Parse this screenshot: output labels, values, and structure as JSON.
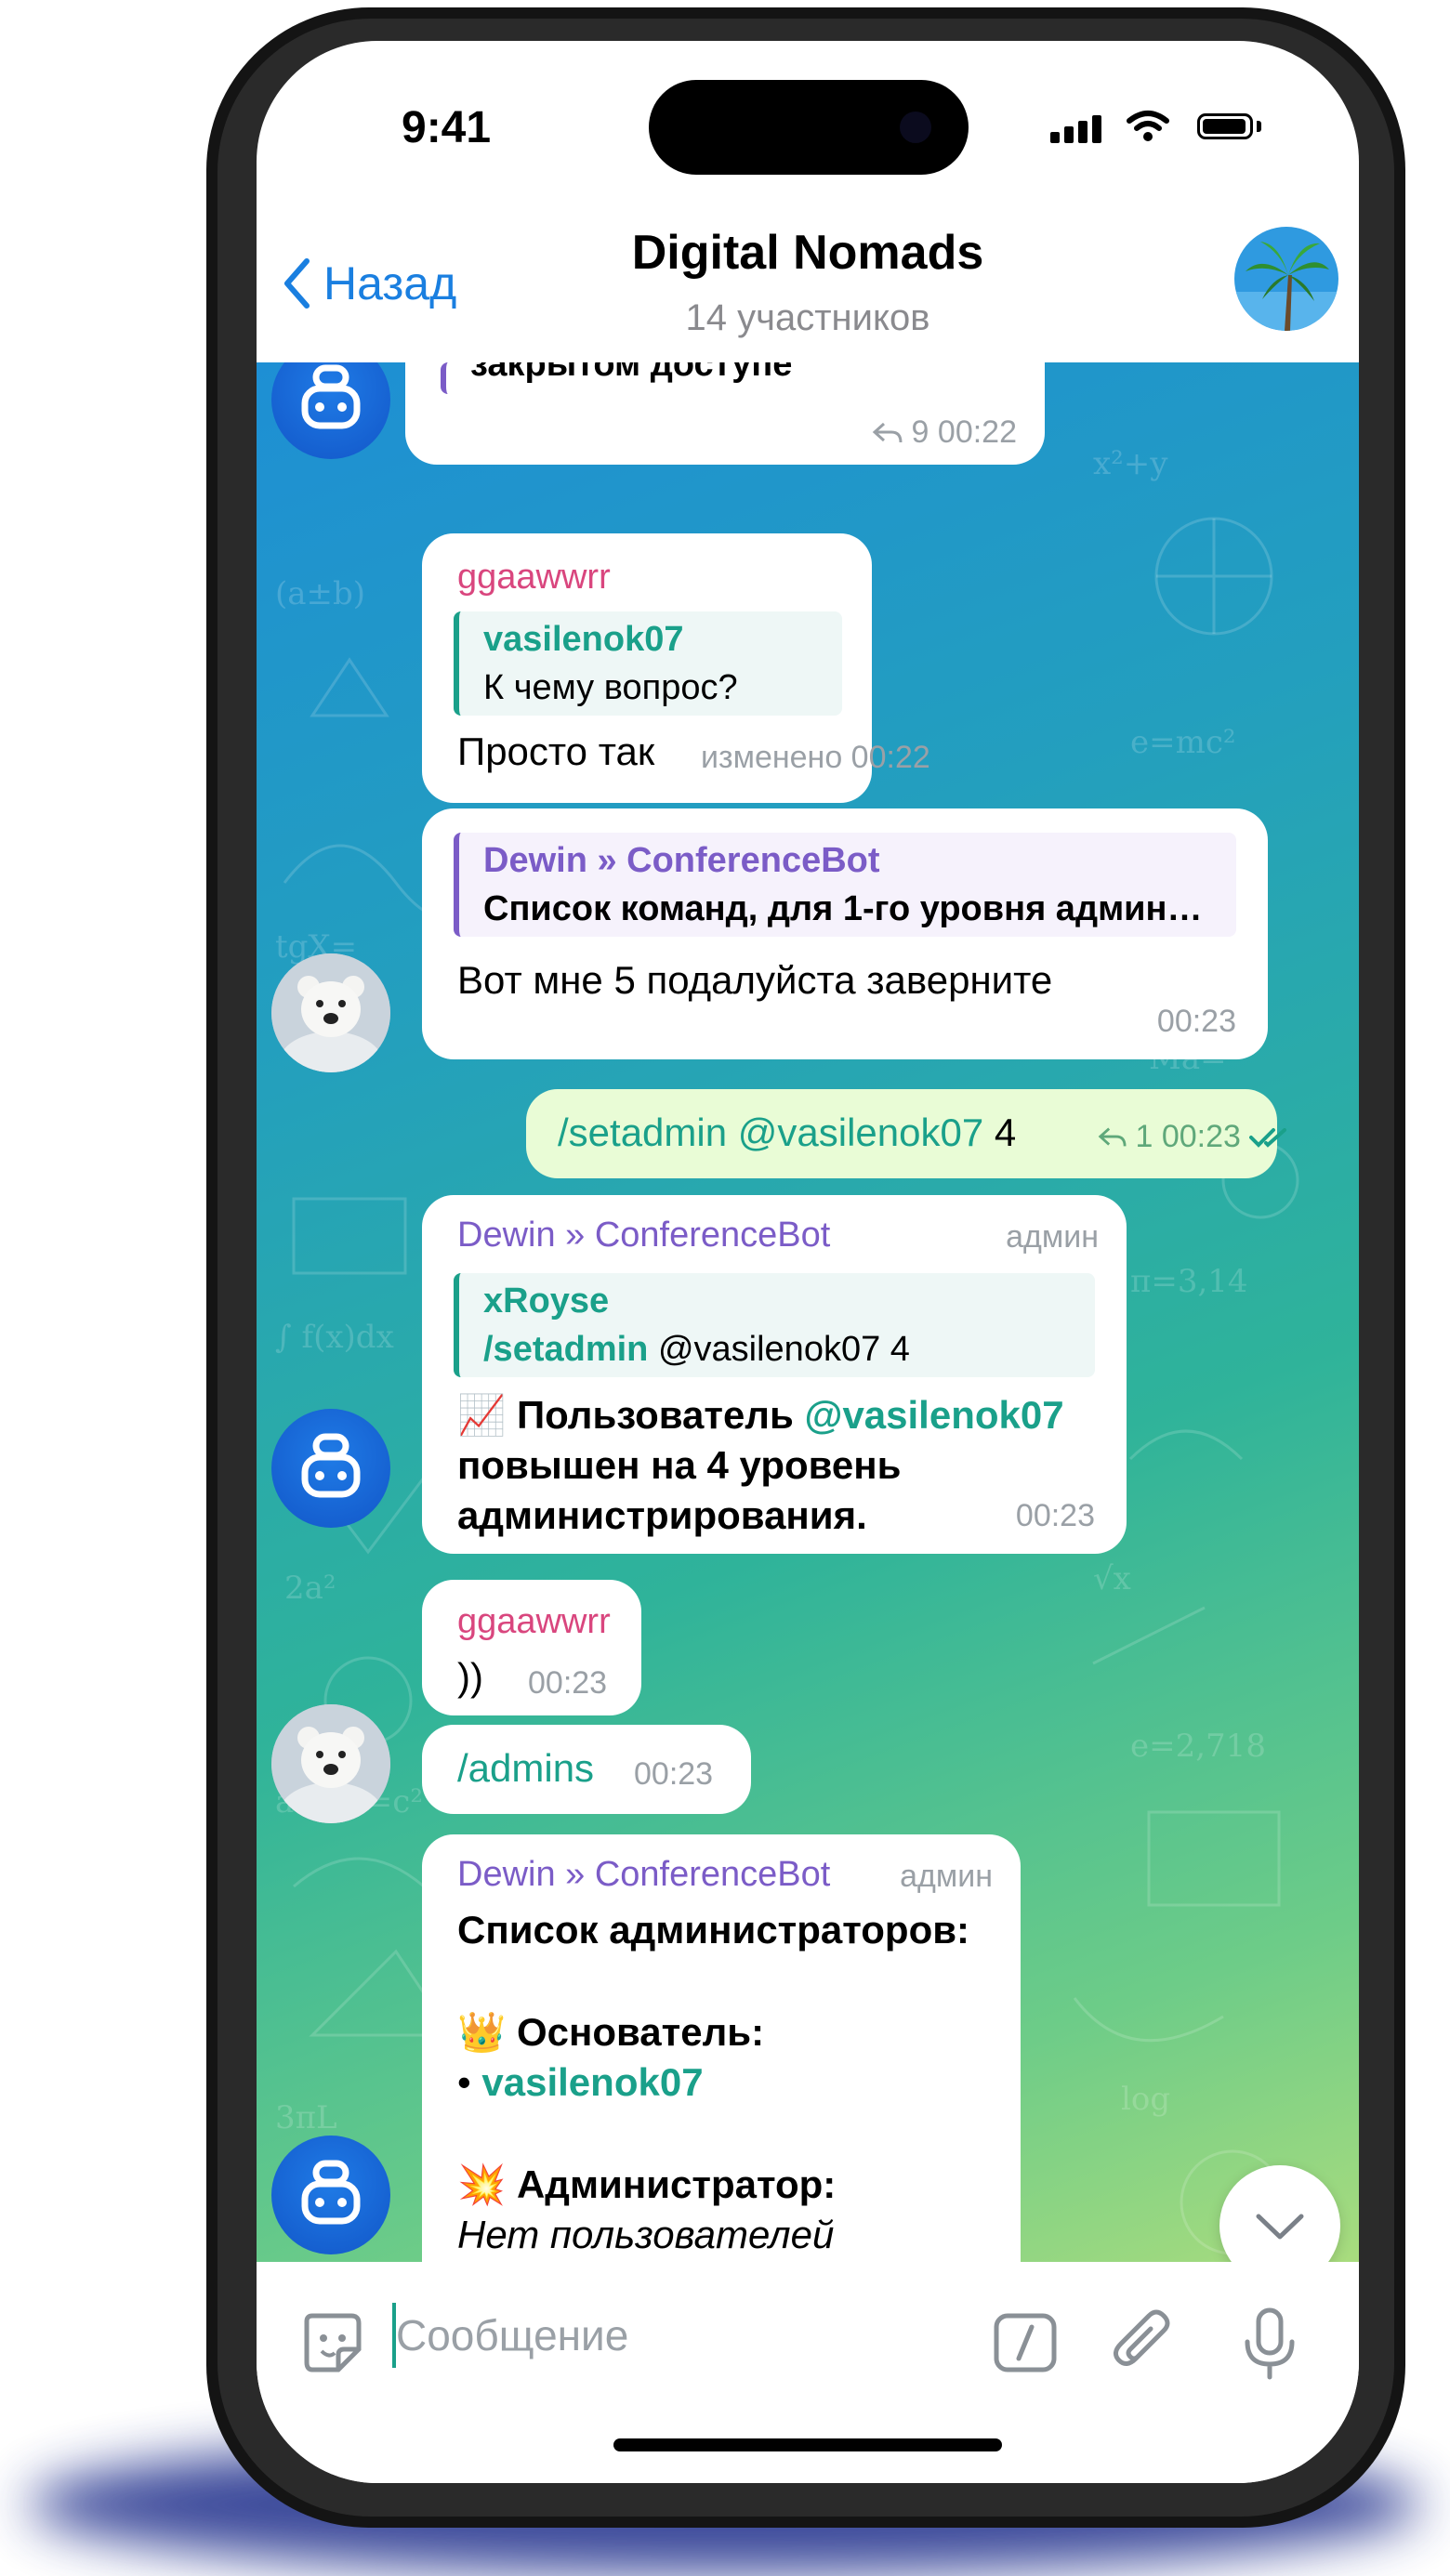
{
  "status_bar": {
    "time": "9:41"
  },
  "header": {
    "back_label": "Назад",
    "title": "Digital Nomads",
    "subtitle": "14 участников"
  },
  "messages": [
    {
      "text_partial": "закрытом доступе",
      "replies": "9",
      "time": "00:22"
    },
    {
      "sender": "ggaawwrr",
      "reply_to_name": "vasilenok07",
      "reply_to_text": "К чему вопрос?",
      "text": "Просто так",
      "edited_time": "изменено 00:22"
    },
    {
      "reply_to_name": "Dewin » ConferenceBot",
      "reply_to_text": "Список команд, для 1-го уровня админ…",
      "text": "Вот мне 5 подалуйста заверните",
      "time": "00:23"
    },
    {
      "command": "/setadmin",
      "mention": "@vasilenok07",
      "arg": "4",
      "replies": "1",
      "time": "00:23"
    },
    {
      "sender": "Dewin » ConferenceBot",
      "role": "админ",
      "reply_to_name": "xRoyse",
      "reply_to_cmd": "/setadmin",
      "reply_to_rest": "@vasilenok07 4",
      "emoji": "📈",
      "line1_prefix": "Пользователь",
      "line1_mention": "@vasilenok07",
      "line2": "повышен на 4 уровень",
      "line3": "администрирования.",
      "time": "00:23"
    },
    {
      "sender": "ggaawwrr",
      "text": "))",
      "time": "00:23"
    },
    {
      "text": "/admins",
      "time": "00:23"
    },
    {
      "sender": "Dewin » ConferenceBot",
      "role": "админ",
      "heading": "Список администраторов:",
      "founder_emoji": "👑",
      "founder_label": "Основатель:",
      "founder_bullet": "•",
      "founder_name": "vasilenok07",
      "admin_emoji": "💥",
      "admin_label": "Администратор:",
      "admin_value": "Нет пользователей"
    }
  ],
  "input": {
    "placeholder": "Сообщение"
  },
  "icons": [
    "chevron-left-icon",
    "palm-tree-avatar",
    "bot-avatar-icon",
    "polar-bear-avatar",
    "reply-icon",
    "double-check-icon",
    "chevron-down-icon",
    "sticker-icon",
    "slash-command-icon",
    "paperclip-icon",
    "microphone-icon"
  ],
  "colors": {
    "accent": "#1a7fe0",
    "sender_pink": "#d9467e",
    "bot_purple": "#7b5cc7",
    "reply_teal": "#1aa08a",
    "outgoing_bubble": "#e9fcd6",
    "check": "#1aa08a"
  }
}
